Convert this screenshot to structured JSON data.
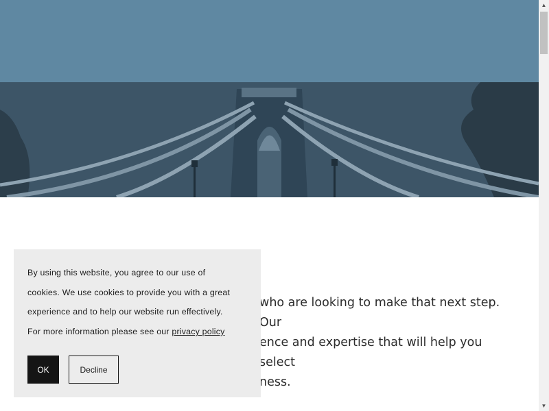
{
  "hero": {
    "icon": "suspension-bridge-photo"
  },
  "intro": {
    "line1_tail": "who are looking to make that next step. Our",
    "line2_tail": "ence and expertise that will help you select",
    "line3_tail": "ness."
  },
  "cookie_banner": {
    "line1": "By using this website, you agree to our use of",
    "line2": "cookies. We use cookies to provide you with a great",
    "line3": "experience and to help our website run effectively.",
    "line4_prefix": "For more information please see our ",
    "privacy_link": "privacy policy",
    "ok_label": "OK",
    "decline_label": "Decline"
  },
  "colors": {
    "top_bar": "#5f88a2",
    "hero_overlay": "#3c5466",
    "cookie_bg": "#ececec",
    "ok_button": "#151515"
  }
}
